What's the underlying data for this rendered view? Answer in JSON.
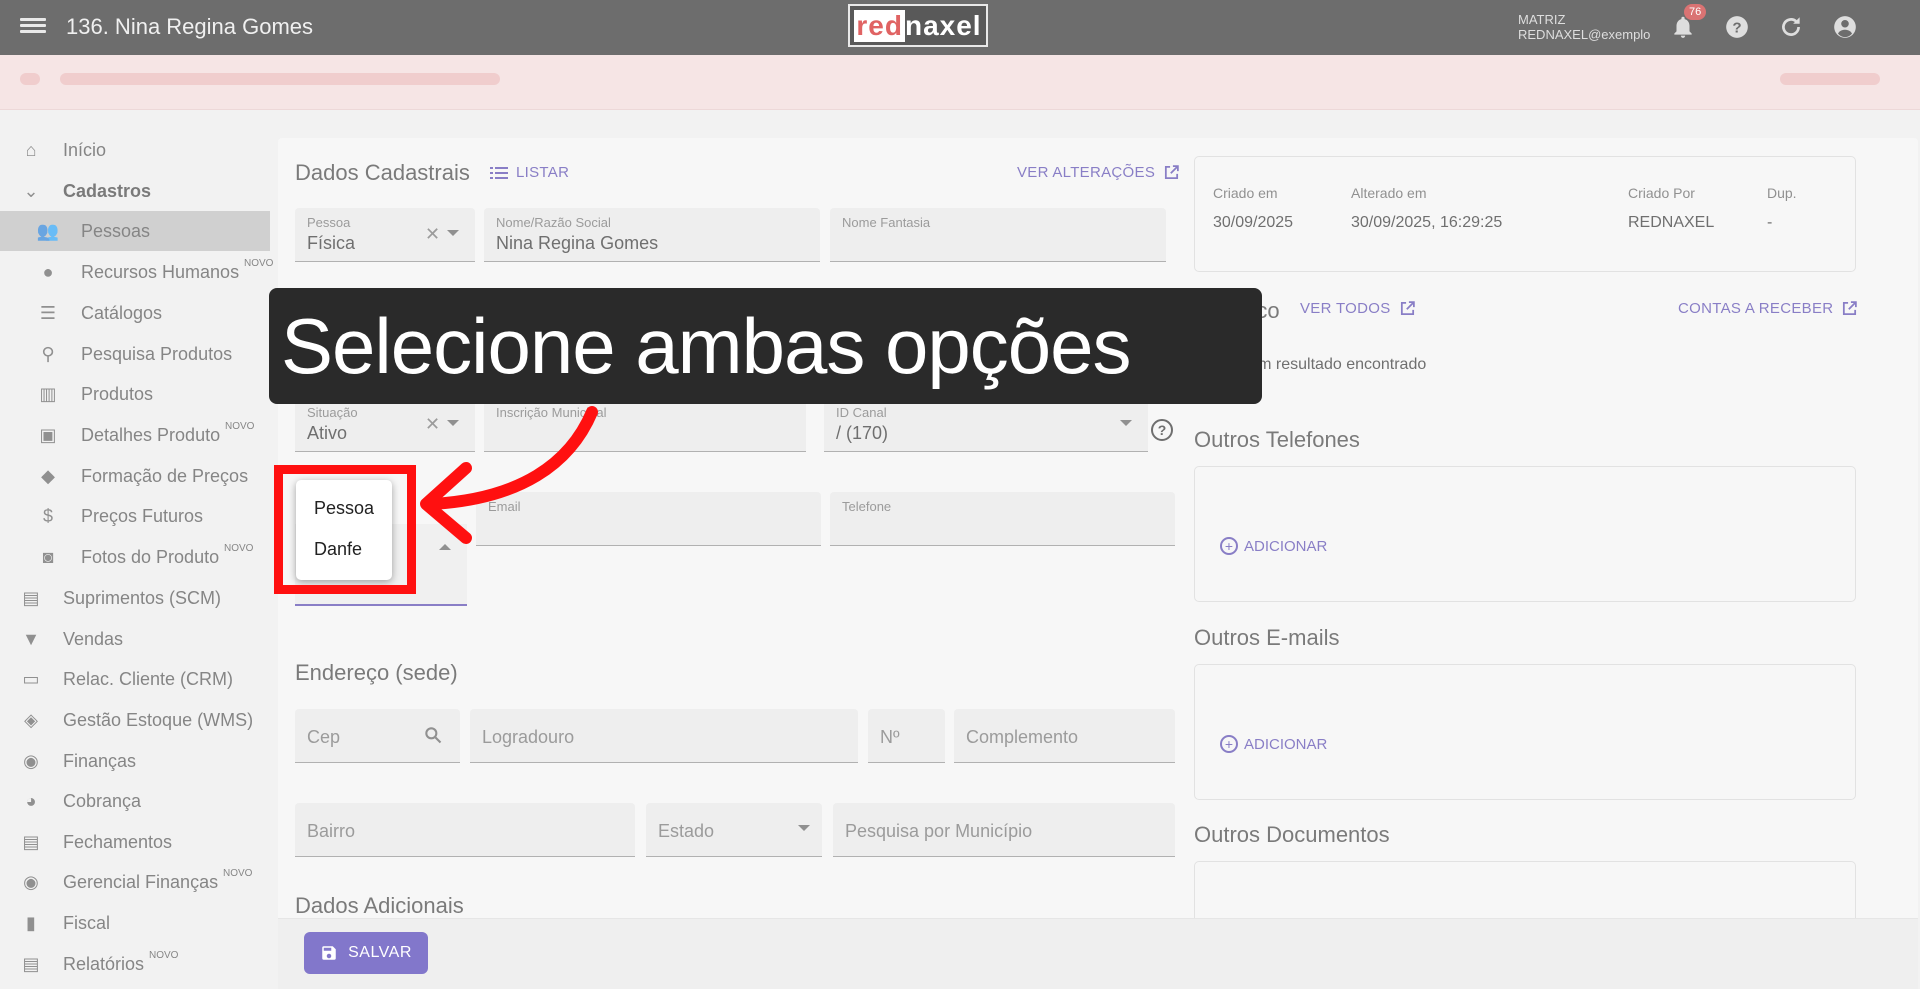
{
  "header": {
    "title": "136. Nina Regina Gomes",
    "logo_red": "red",
    "logo_white": "naxel",
    "company_line1": "MATRIZ",
    "company_line2": "REDNAXEL@exemplo",
    "notification_count": "76"
  },
  "sidebar": {
    "items": [
      {
        "label": "Início",
        "icon": "home-icon"
      },
      {
        "label": "Cadastros",
        "icon": "chevron-down-icon"
      },
      {
        "label": "Pessoas",
        "icon": "people-icon"
      },
      {
        "label": "Recursos Humanos",
        "icon": "person-icon",
        "tag": "NOVO"
      },
      {
        "label": "Catálogos",
        "icon": "list-icon"
      },
      {
        "label": "Pesquisa Produtos",
        "icon": "search-icon"
      },
      {
        "label": "Produtos",
        "icon": "barcode-icon"
      },
      {
        "label": "Detalhes Produto",
        "icon": "doc-search-icon",
        "tag": "NOVO"
      },
      {
        "label": "Formação de Preços",
        "icon": "tag-icon"
      },
      {
        "label": "Preços Futuros",
        "icon": "dollar-icon"
      },
      {
        "label": "Fotos do Produto",
        "icon": "camera-icon",
        "tag": "NOVO"
      },
      {
        "label": "Suprimentos (SCM)",
        "icon": "supply-icon"
      },
      {
        "label": "Vendas",
        "icon": "cart-icon"
      },
      {
        "label": "Relac. Cliente (CRM)",
        "icon": "contact-card-icon"
      },
      {
        "label": "Gestão Estoque (WMS)",
        "icon": "directions-icon"
      },
      {
        "label": "Finanças",
        "icon": "coin-icon"
      },
      {
        "label": "Cobrança",
        "icon": "pie-icon"
      },
      {
        "label": "Fechamentos",
        "icon": "receipt-icon"
      },
      {
        "label": "Gerencial Finanças",
        "icon": "coin-icon",
        "tag": "NOVO"
      },
      {
        "label": "Fiscal",
        "icon": "book-icon"
      },
      {
        "label": "Relatórios",
        "icon": "report-icon",
        "tag": "NOVO"
      }
    ]
  },
  "form": {
    "title": "Dados Cadastrais",
    "listar": "LISTAR",
    "ver_alteracoes": "VER ALTERAÇÕES",
    "pessoa_label": "Pessoa",
    "pessoa_value": "Física",
    "nome_label": "Nome/Razão Social",
    "nome_value": "Nina Regina Gomes",
    "fantasia_label": "Nome Fantasia",
    "situacao_label": "Situação",
    "situacao_value": "Ativo",
    "inscricao_label": "Inscrição Municipal",
    "canal_label": "ID Canal",
    "canal_value": "/ (170)",
    "email_label": "Email",
    "telefone_label": "Telefone",
    "partial_value": "Danfe"
  },
  "endereco": {
    "title": "Endereço (sede)",
    "cep": "Cep",
    "logradouro": "Logradouro",
    "numero": "Nº",
    "complemento": "Complemento",
    "bairro": "Bairro",
    "estado": "Estado",
    "municipio": "Pesquisa por Município"
  },
  "adicionais": {
    "title": "Dados Adicionais"
  },
  "info": {
    "criado_em_label": "Criado em",
    "criado_em": "30/09/2025",
    "alterado_em_label": "Alterado em",
    "alterado_em": "30/09/2025, 16:29:25",
    "criado_por_label": "Criado Por",
    "criado_por": "REDNAXEL",
    "dup_label": "Dup.",
    "dup": "-"
  },
  "historico": {
    "title": "Histórico",
    "ver_todos": "VER TODOS",
    "contas": "CONTAS A RECEBER",
    "empty": "Nenhum resultado encontrado"
  },
  "outros": {
    "telefones": "Outros Telefones",
    "emails": "Outros E-mails",
    "documentos": "Outros Documentos",
    "adicionar": "ADICIONAR"
  },
  "footer": {
    "save": "SALVAR"
  },
  "tutorial": {
    "caption": "Selecione ambas opções"
  },
  "dropdown": {
    "options": [
      "Pessoa",
      "Danfe"
    ]
  },
  "colors": {
    "accent": "#4a3aa8",
    "highlight": "#ff1010",
    "topbar": "#1f1f1f"
  }
}
